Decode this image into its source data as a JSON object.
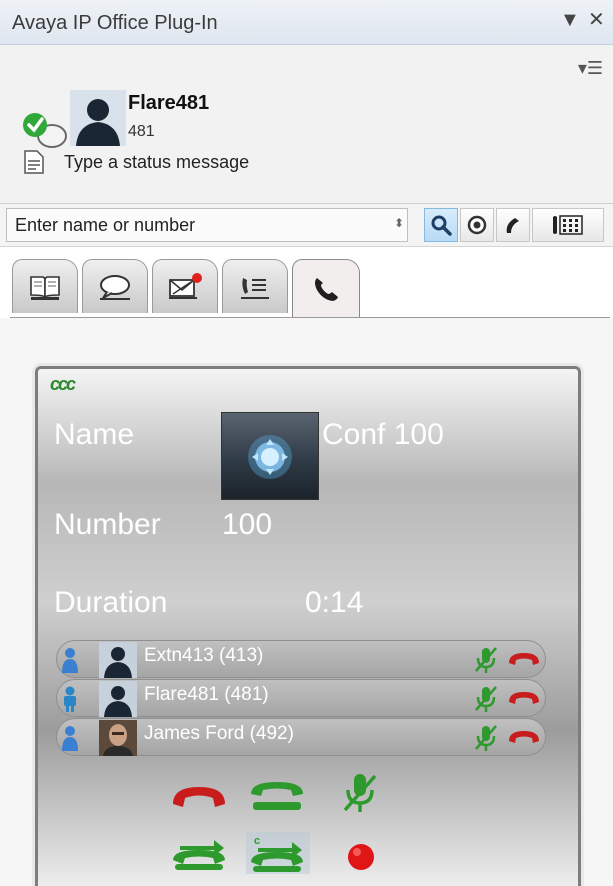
{
  "window": {
    "title": "Avaya IP Office Plug-In",
    "dropdown_icon": "dropdown-arrow-icon",
    "close_icon": "close-icon"
  },
  "header": {
    "menu_icon": "menu-icon",
    "user_name": "Flare481",
    "user_extension": "481",
    "status_placeholder": "Type a status message",
    "presence": "available"
  },
  "search": {
    "placeholder": "Enter name or number",
    "buttons": [
      "search-icon",
      "voicemail-icon",
      "call-icon",
      "dialpad-icon"
    ]
  },
  "tabs": [
    {
      "name": "directory",
      "icon": "directory-icon"
    },
    {
      "name": "messaging",
      "icon": "chat-icon"
    },
    {
      "name": "voicemail",
      "icon": "voicemail-icon",
      "badge": true
    },
    {
      "name": "call-history",
      "icon": "call-history-icon"
    },
    {
      "name": "calls",
      "icon": "phone-icon",
      "active": true
    }
  ],
  "conference": {
    "name_label": "Name",
    "name_value": "Conf 100",
    "number_label": "Number",
    "number_value": "100",
    "duration_label": "Duration",
    "duration_value": "0:14",
    "participants": [
      {
        "name": "Extn413 (413)",
        "type": "user"
      },
      {
        "name": "Flare481 (481)",
        "type": "self"
      },
      {
        "name": "James Ford (492)",
        "type": "user"
      }
    ],
    "controls_row1": [
      "hangup-icon",
      "hold-icon",
      "mute-icon"
    ],
    "controls_row2": [
      "transfer-icon",
      "conference-transfer-icon",
      "record-icon"
    ]
  },
  "colors": {
    "accent_green": "#2e9a2e",
    "hangup_red": "#c91c1c",
    "record_red": "#e01515",
    "title_bar": "#e3e9f1"
  }
}
